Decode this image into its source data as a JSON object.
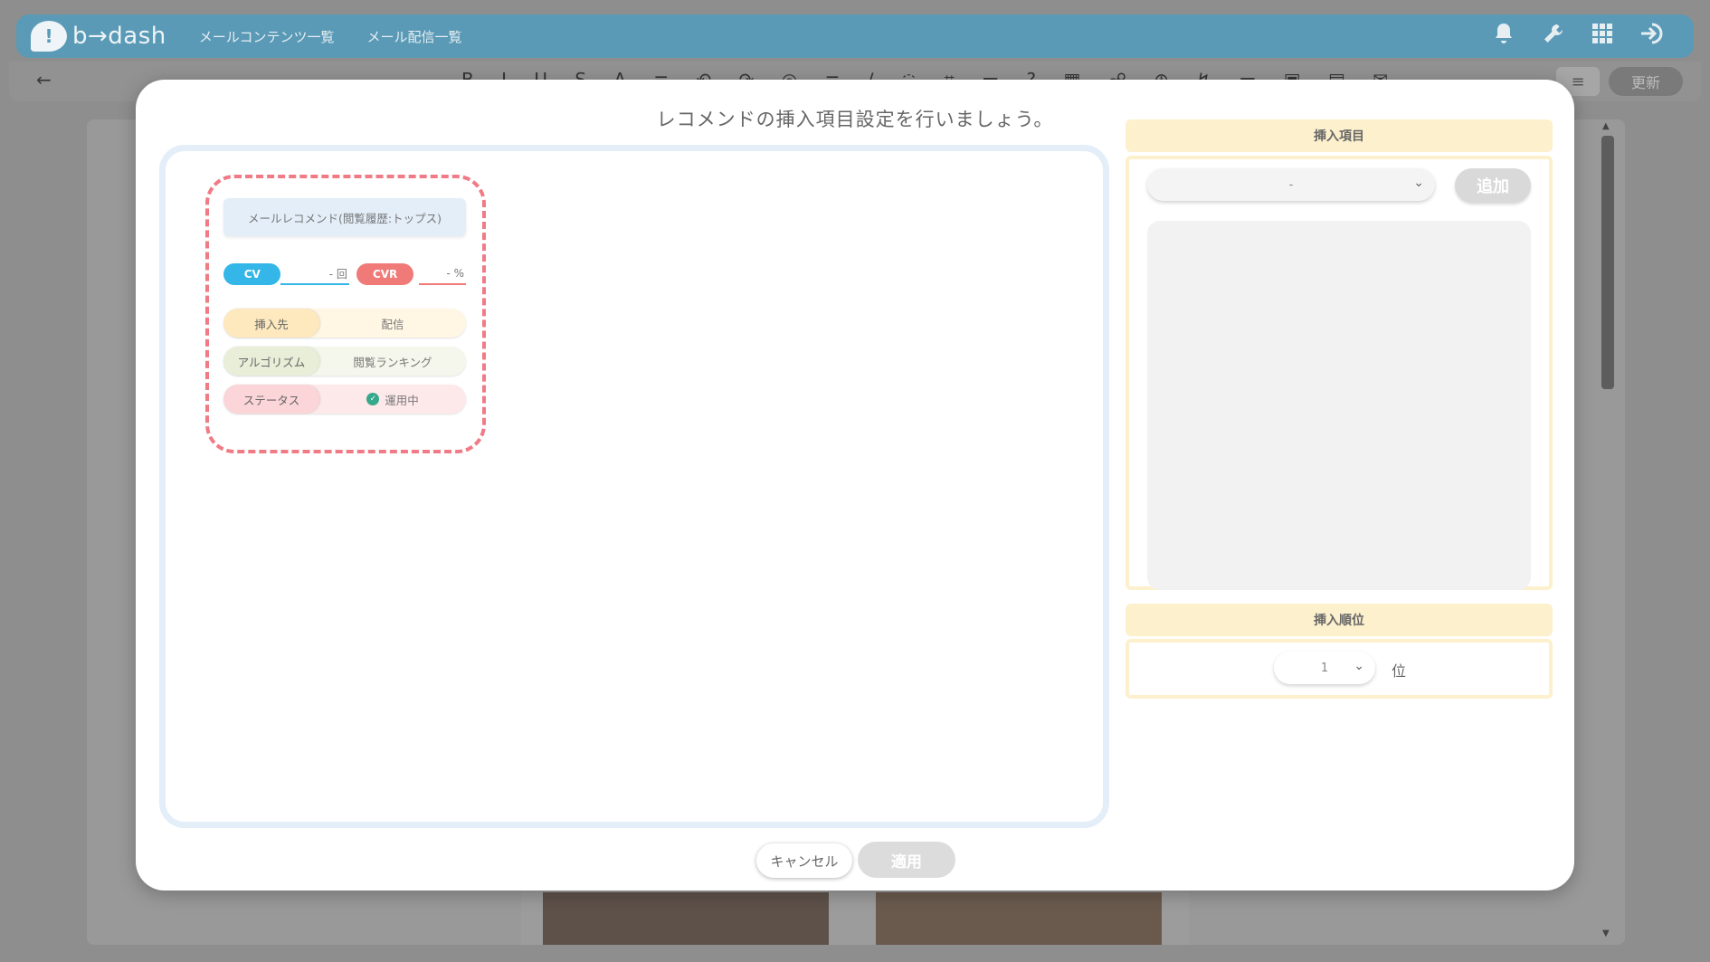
{
  "app": {
    "logo_mark": "!",
    "logo_text": "b→dash",
    "nav": [
      "メールコンテンツ一覧",
      "メール配信一覧"
    ],
    "icons": [
      "bell-icon",
      "wrench-icon",
      "grid-icon",
      "logout-icon"
    ]
  },
  "toolbar": {
    "back": "←",
    "update_label": "更新"
  },
  "modal": {
    "title": "レコメンドの挿入項目設定を行いましょう。",
    "card": {
      "title": "メールレコメンド(閲覧履歴:トップス)",
      "cv_label": "CV",
      "cv_value": "- 回",
      "cvr_label": "CVR",
      "cvr_value": "- %",
      "rows": [
        {
          "key": "挿入先",
          "value": "配信"
        },
        {
          "key": "アルゴリズム",
          "value": "閲覧ランキング"
        },
        {
          "key": "ステータス",
          "value": "運用中"
        }
      ]
    },
    "insert_items": {
      "header": "挿入項目",
      "select_value": "-",
      "add_label": "追加"
    },
    "insert_rank": {
      "header": "挿入順位",
      "select_value": "1",
      "unit": "位"
    },
    "cancel_label": "キャンセル",
    "apply_label": "適用"
  },
  "colors": {
    "header_blue": "#5a9ab6",
    "cv_blue": "#35b6e9",
    "cvr_red": "#f07a78",
    "dash_border": "#f07a85",
    "side_yellow": "#fdf0cd"
  }
}
